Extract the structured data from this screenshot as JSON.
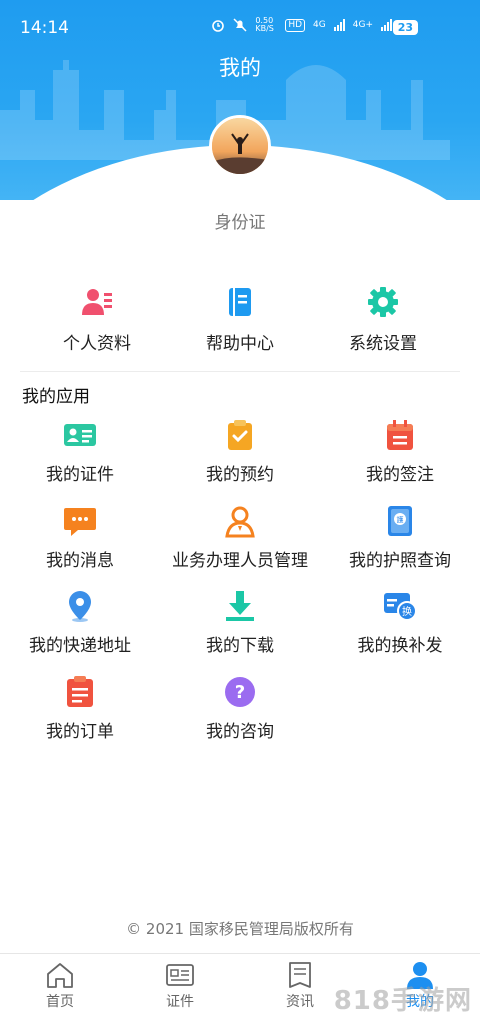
{
  "status": {
    "time": "14:14",
    "speed": "0.50 KB/S",
    "signal1": "4G",
    "signal2": "4G+",
    "battery": "23"
  },
  "header": {
    "title": "我的"
  },
  "profile": {
    "label": "身份证"
  },
  "quick_actions": [
    {
      "label": "个人资料",
      "icon": "profile-card-icon",
      "color": "#f0506e"
    },
    {
      "label": "帮助中心",
      "icon": "help-book-icon",
      "color": "#1e9af0"
    },
    {
      "label": "系统设置",
      "icon": "gear-icon",
      "color": "#1bc7a6"
    }
  ],
  "apps_section": {
    "title": "我的应用"
  },
  "apps": [
    {
      "label": "我的证件",
      "icon": "id-card-icon",
      "color": "#2bc7a1"
    },
    {
      "label": "我的预约",
      "icon": "clipboard-check-icon",
      "color": "#f5a623"
    },
    {
      "label": "我的签注",
      "icon": "calendar-icon",
      "color": "#f0533f"
    },
    {
      "label": "我的消息",
      "icon": "chat-bubble-icon",
      "color": "#f5821f"
    },
    {
      "label": "业务办理人员管理",
      "icon": "person-outline-icon",
      "color": "#f5821f"
    },
    {
      "label": "我的护照查询",
      "icon": "passport-icon",
      "color": "#2a86e8"
    },
    {
      "label": "我的快递地址",
      "icon": "location-pin-icon",
      "color": "#3b8fe8"
    },
    {
      "label": "我的下载",
      "icon": "download-icon",
      "color": "#1bc7a6"
    },
    {
      "label": "我的换补发",
      "icon": "exchange-card-icon",
      "color": "#2a86e8"
    },
    {
      "label": "我的订单",
      "icon": "order-list-icon",
      "color": "#f0533f"
    },
    {
      "label": "我的咨询",
      "icon": "question-circle-icon",
      "color": "#9b6cf0"
    }
  ],
  "footer": {
    "copyright": "© 2021 国家移民管理局版权所有"
  },
  "tabs": [
    {
      "label": "首页",
      "icon": "home-icon"
    },
    {
      "label": "证件",
      "icon": "id-doc-icon"
    },
    {
      "label": "资讯",
      "icon": "news-icon"
    },
    {
      "label": "我的",
      "icon": "user-icon",
      "active": true
    }
  ],
  "watermark": "818手游网"
}
